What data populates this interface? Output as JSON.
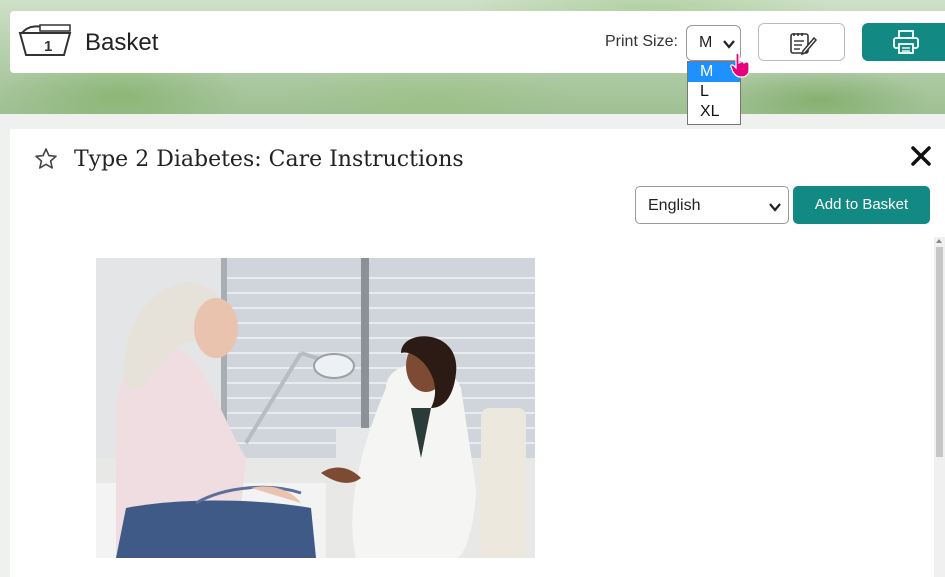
{
  "header": {
    "basket_title": "Basket",
    "basket_count": "1",
    "print_size_label": "Print Size:",
    "print_size_value": "M",
    "print_size_options": [
      "M",
      "L",
      "XL"
    ],
    "notes_icon": "notes-edit-icon",
    "print_icon": "printer-icon"
  },
  "document": {
    "title": "Type 2 Diabetes: Care Instructions",
    "language_value": "English",
    "add_to_basket_label": "Add to Basket",
    "favorite_icon": "star-outline-icon",
    "close_icon": "close-icon"
  },
  "colors": {
    "accent": "#138984",
    "dropdown_highlight": "#1e90ff",
    "cursor": "#e6007e"
  }
}
